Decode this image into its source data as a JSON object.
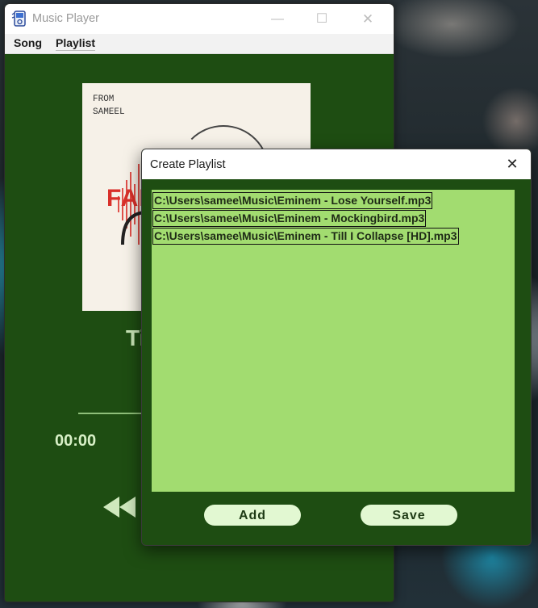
{
  "main_window": {
    "title": "Music Player",
    "controls": {
      "minimize": "—",
      "maximize": "☐",
      "close": "✕"
    },
    "menu": {
      "song": "Song",
      "playlist": "Playlist"
    },
    "album_art": {
      "line1": "FROM",
      "line2": "SAMEEL",
      "word": "FAD"
    },
    "now_playing_title": "Ti",
    "elapsed_time": "00:00"
  },
  "dialog": {
    "title": "Create Playlist",
    "close": "✕",
    "playlist_items": [
      "C:\\Users\\samee\\Music\\Eminem - Lose Yourself.mp3",
      "C:\\Users\\samee\\Music\\Eminem - Mockingbird.mp3",
      "C:\\Users\\samee\\Music\\Eminem - Till I Collapse [HD].mp3"
    ],
    "add_label": "Add",
    "save_label": "Save"
  },
  "colors": {
    "window_bg": "#1e4d12",
    "list_bg": "#a2dc70",
    "button_bg": "#e2f8d2"
  }
}
